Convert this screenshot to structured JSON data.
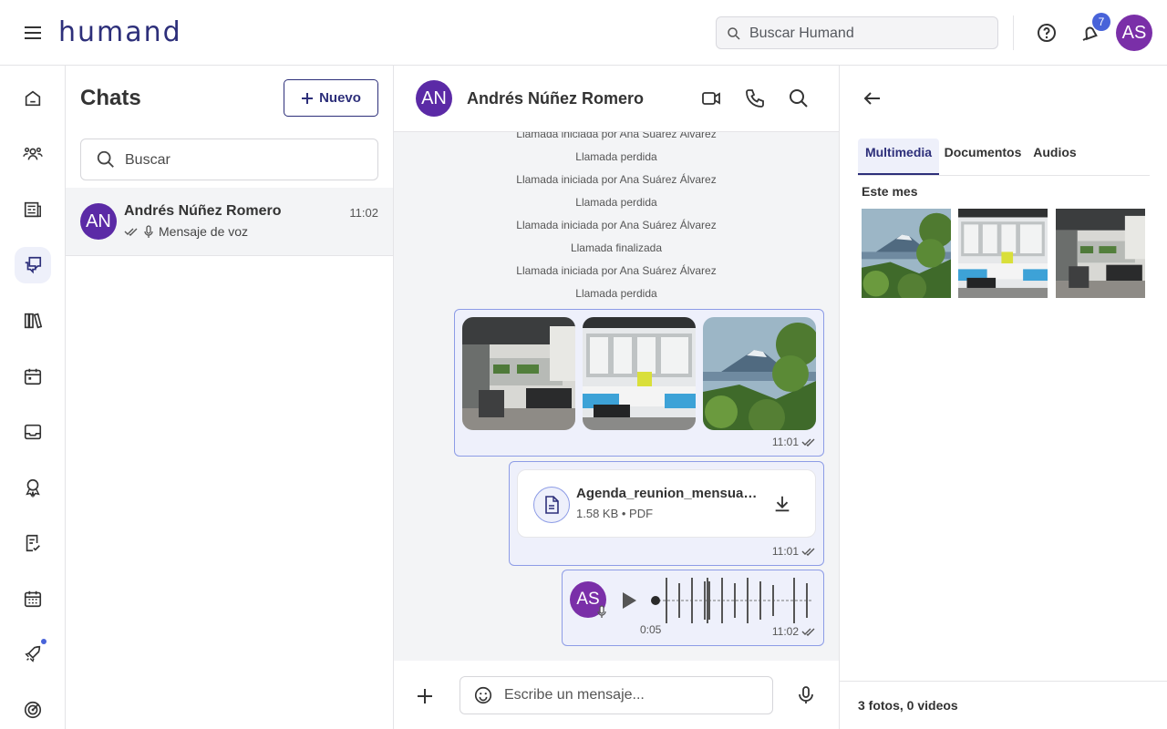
{
  "app": {
    "logo": "humand"
  },
  "topbar": {
    "search_placeholder": "Buscar Humand",
    "notification_count": "7",
    "user_initials": "AS"
  },
  "sidebar": {
    "items": [
      "home",
      "people",
      "news",
      "chats",
      "library",
      "calendar",
      "inbox",
      "recognition",
      "forms",
      "events",
      "onboarding",
      "goals"
    ],
    "active": "chats"
  },
  "chats": {
    "title": "Chats",
    "new_label": "Nuevo",
    "search_placeholder": "Buscar",
    "items": [
      {
        "initials": "AN",
        "name": "Andrés Núñez Romero",
        "time": "11:02",
        "preview": "Mensaje de voz"
      }
    ]
  },
  "conversation": {
    "contact_initials": "AN",
    "contact_name": "Andrés Núñez Romero",
    "system_messages": [
      "Llamada iniciada por Ana Suárez Álvarez",
      "Llamada perdida",
      "Llamada iniciada por Ana Suárez Álvarez",
      "Llamada perdida",
      "Llamada iniciada por Ana Suárez Álvarez",
      "Llamada finalizada",
      "Llamada iniciada por Ana Suárez Álvarez",
      "Llamada perdida"
    ],
    "photo_message_time": "11:01",
    "file": {
      "name": "Agenda_reunion_mensual.pdf",
      "meta": "1.58 KB • PDF",
      "time": "11:01"
    },
    "voice": {
      "initials": "AS",
      "duration": "0:05",
      "time": "11:02"
    },
    "composer_placeholder": "Escribe un mensaje..."
  },
  "media_panel": {
    "tabs": [
      "Multimedia",
      "Documentos",
      "Audios"
    ],
    "active_tab": "Multimedia",
    "section": "Este mes",
    "footer": "3 fotos, 0 videos"
  },
  "colors": {
    "brand": "#2d2f7a",
    "accent": "#4863d9",
    "avatar_an": "#5b2aa6",
    "avatar_as": "#7a2fa8",
    "bubble": "#eef0fb"
  }
}
